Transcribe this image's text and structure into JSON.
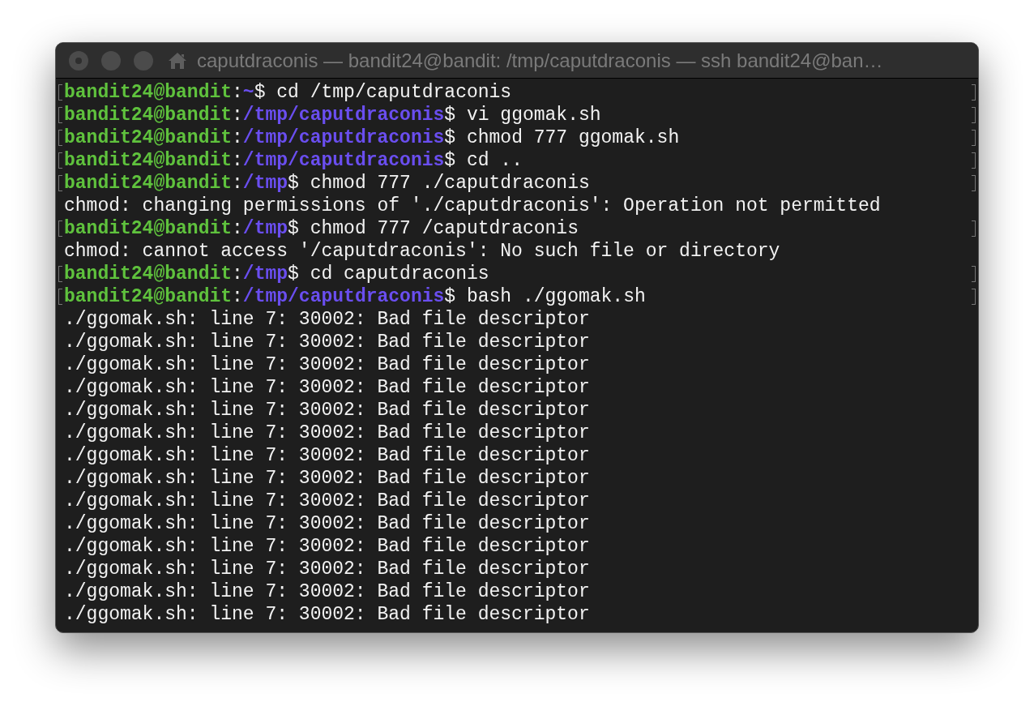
{
  "window": {
    "title": "caputdraconis — bandit24@bandit: /tmp/caputdraconis — ssh bandit24@ban…"
  },
  "terminal": {
    "lines": [
      {
        "kind": "prompt",
        "marked": true,
        "user": "bandit24@bandit",
        "colon": ":",
        "path": "~",
        "sign": "$",
        "command": "cd /tmp/caputdraconis"
      },
      {
        "kind": "prompt",
        "marked": true,
        "user": "bandit24@bandit",
        "colon": ":",
        "path": "/tmp/caputdraconis",
        "sign": "$",
        "command": "vi ggomak.sh"
      },
      {
        "kind": "prompt",
        "marked": true,
        "user": "bandit24@bandit",
        "colon": ":",
        "path": "/tmp/caputdraconis",
        "sign": "$",
        "command": "chmod 777 ggomak.sh"
      },
      {
        "kind": "prompt",
        "marked": true,
        "user": "bandit24@bandit",
        "colon": ":",
        "path": "/tmp/caputdraconis",
        "sign": "$",
        "command": "cd .."
      },
      {
        "kind": "prompt",
        "marked": true,
        "user": "bandit24@bandit",
        "colon": ":",
        "path": "/tmp",
        "sign": "$",
        "command": "chmod 777 ./caputdraconis"
      },
      {
        "kind": "output",
        "text": "chmod: changing permissions of './caputdraconis': Operation not permitted"
      },
      {
        "kind": "prompt",
        "marked": true,
        "user": "bandit24@bandit",
        "colon": ":",
        "path": "/tmp",
        "sign": "$",
        "command": "chmod 777 /caputdraconis"
      },
      {
        "kind": "output",
        "text": "chmod: cannot access '/caputdraconis': No such file or directory"
      },
      {
        "kind": "prompt",
        "marked": true,
        "user": "bandit24@bandit",
        "colon": ":",
        "path": "/tmp",
        "sign": "$",
        "command": "cd caputdraconis"
      },
      {
        "kind": "prompt",
        "marked": true,
        "user": "bandit24@bandit",
        "colon": ":",
        "path": "/tmp/caputdraconis",
        "sign": "$",
        "command": "bash ./ggomak.sh"
      },
      {
        "kind": "output",
        "text": "./ggomak.sh: line 7: 30002: Bad file descriptor"
      },
      {
        "kind": "output",
        "text": "./ggomak.sh: line 7: 30002: Bad file descriptor"
      },
      {
        "kind": "output",
        "text": "./ggomak.sh: line 7: 30002: Bad file descriptor"
      },
      {
        "kind": "output",
        "text": "./ggomak.sh: line 7: 30002: Bad file descriptor"
      },
      {
        "kind": "output",
        "text": "./ggomak.sh: line 7: 30002: Bad file descriptor"
      },
      {
        "kind": "output",
        "text": "./ggomak.sh: line 7: 30002: Bad file descriptor"
      },
      {
        "kind": "output",
        "text": "./ggomak.sh: line 7: 30002: Bad file descriptor"
      },
      {
        "kind": "output",
        "text": "./ggomak.sh: line 7: 30002: Bad file descriptor"
      },
      {
        "kind": "output",
        "text": "./ggomak.sh: line 7: 30002: Bad file descriptor"
      },
      {
        "kind": "output",
        "text": "./ggomak.sh: line 7: 30002: Bad file descriptor"
      },
      {
        "kind": "output",
        "text": "./ggomak.sh: line 7: 30002: Bad file descriptor"
      },
      {
        "kind": "output",
        "text": "./ggomak.sh: line 7: 30002: Bad file descriptor"
      },
      {
        "kind": "output",
        "text": "./ggomak.sh: line 7: 30002: Bad file descriptor"
      },
      {
        "kind": "output",
        "text": "./ggomak.sh: line 7: 30002: Bad file descriptor"
      }
    ]
  }
}
